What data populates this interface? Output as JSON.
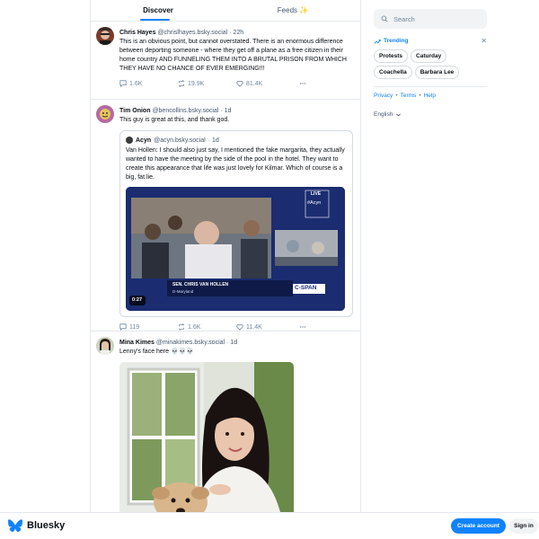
{
  "tabs": [
    {
      "label": "Discover"
    },
    {
      "label": "Feeds ✨"
    }
  ],
  "posts": [
    {
      "author": "Chris Hayes",
      "handle": "@chrislhayes.bsky.social",
      "time": "· 22h",
      "text": "This is an obvious point, but cannot overstated. There is an enormous difference between deporting someone - where they get off a plane as a free citizen in their home country AND FUNNELING THEM INTO A BRUTAL PRISON FROM WHICH THEY HAVE NO CHANCE OF EVER EMERGING!!!",
      "replies": "1.6K",
      "reposts": "19.9K",
      "likes": "81.4K"
    },
    {
      "author": "Tim Onion",
      "handle": "@bencollins.bsky.social",
      "time": "· 1d",
      "text": "This guy is great at this, and thank god.",
      "quote": {
        "author": "Acyn",
        "handle": "@acyn.bsky.social",
        "time": "· 1d",
        "text": "Van Hollen: I should also just say, I mentioned the fake margarita, they actually wanted to have the meeting by the side of the pool in the hotel.  They want to create this appearance that life was just lovely for Kilmar. Which of course is a big, fat lie.",
        "video": {
          "duration": "0:27",
          "live_label": "LIVE",
          "tag": "#Acyn",
          "chyron_name": "SEN. CHRIS VAN HOLLEN",
          "chyron_sub": "D-Maryland",
          "network": "C-SPAN"
        }
      },
      "replies": "119",
      "reposts": "1.6K",
      "likes": "11.4K"
    },
    {
      "author": "Mina Kimes",
      "handle": "@minakimes.bsky.social",
      "time": "· 1d",
      "text": "Lenny's face here 💀💀💀"
    }
  ],
  "sidebar": {
    "search_placeholder": "Search",
    "trending_label": "Trending",
    "trending": [
      "Protests",
      "Caturday",
      "Coachella",
      "Barbara Lee"
    ],
    "links": [
      "Privacy",
      "Terms",
      "Help"
    ],
    "language": "English"
  },
  "bottom": {
    "brand": "Bluesky",
    "create_account": "Create account",
    "sign_in": "Sign in"
  },
  "colors": {
    "accent": "#1083fe",
    "muted": "#6f869f",
    "border": "#e4e8ee"
  }
}
